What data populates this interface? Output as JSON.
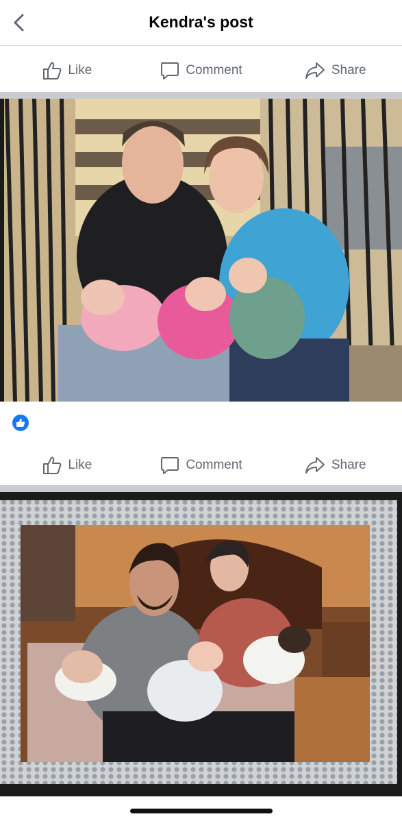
{
  "header": {
    "title": "Kendra's post"
  },
  "actions": {
    "like": "Like",
    "comment": "Comment",
    "share": "Share"
  },
  "photos": [
    {
      "name": "first-family-photo"
    },
    {
      "name": "second-family-photo"
    }
  ],
  "colors": {
    "accent": "#1877f2",
    "action_text": "#606770",
    "divider": "#c9ccd1"
  }
}
